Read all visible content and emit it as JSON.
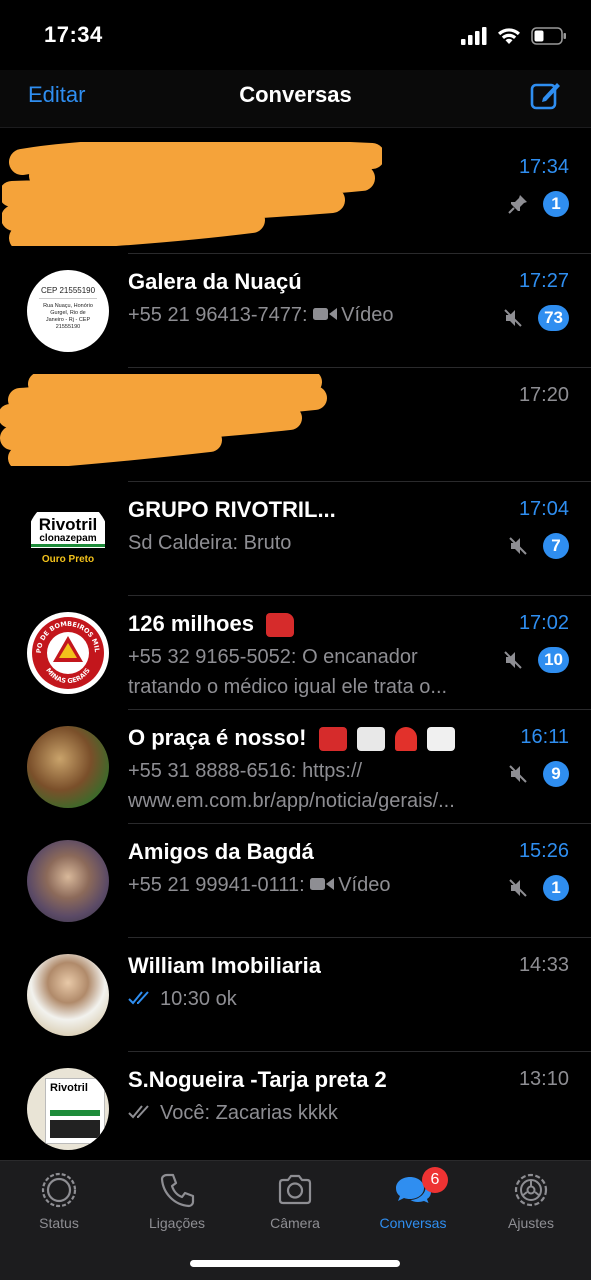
{
  "status_bar": {
    "time": "17:34"
  },
  "nav": {
    "edit_label": "Editar",
    "title": "Conversas"
  },
  "chats": [
    {
      "name": "",
      "preview": "",
      "time": "17:34",
      "time_unread": true,
      "pinned": true,
      "badge": "1"
    },
    {
      "name": "Galera da Nuaçú",
      "sender": "+55 21 96413-7477:",
      "preview": "Vídeo",
      "time": "17:27",
      "time_unread": true,
      "muted": true,
      "badge": "73",
      "avatar_text": {
        "line1": "CEP 21555190",
        "line2": "Rua Nuaçu, Honório Gurgel, Rio de Janeiro - Rj - CEP 21555190"
      }
    },
    {
      "name": "",
      "preview": "",
      "time": "17:20",
      "time_unread": false
    },
    {
      "name": "GRUPO RIVOTRIL...",
      "sender": "Sd Caldeira:",
      "preview": "Bruto",
      "time": "17:04",
      "time_unread": true,
      "muted": true,
      "badge": "7",
      "avatar_text": {
        "brand": "Rivotril",
        "drug": "clonazepam",
        "city": "Ouro Preto"
      }
    },
    {
      "name": "126 milhoes",
      "sender": "+55 32 9165-5052:",
      "preview": "O encanador tratando o médico igual ele trata o...",
      "time": "17:02",
      "time_unread": true,
      "muted": true,
      "badge": "10",
      "avatar_text": {
        "top": "CORPO DE BOMBEIROS MILITAR",
        "bottom": "MINAS GERAIS"
      }
    },
    {
      "name": "O praça é nosso!",
      "sender": "+55 31 8888-6516:",
      "preview": "https:// www.em.com.br/app/noticia/gerais/...",
      "time": "16:11",
      "time_unread": true,
      "muted": true,
      "badge": "9"
    },
    {
      "name": "Amigos da Bagdá",
      "sender": "+55 21 99941-0111:",
      "preview": "Vídeo",
      "time": "15:26",
      "time_unread": true,
      "muted": true,
      "badge": "1"
    },
    {
      "name": "William Imobiliaria",
      "preview": "10:30 ok",
      "time": "14:33",
      "time_unread": false,
      "read": true
    },
    {
      "name": "S.Nogueira -Tarja preta 2",
      "sender": "Você:",
      "preview": "Zacarias kkkk",
      "time": "13:10",
      "time_unread": false,
      "delivered": true,
      "avatar_text": {
        "brand": "Rivotril"
      }
    }
  ],
  "tabs": [
    {
      "label": "Status",
      "icon": "status-icon"
    },
    {
      "label": "Ligações",
      "icon": "phone-icon"
    },
    {
      "label": "Câmera",
      "icon": "camera-icon"
    },
    {
      "label": "Conversas",
      "icon": "chat-bubbles-icon",
      "active": true,
      "badge": "6"
    },
    {
      "label": "Ajustes",
      "icon": "gear-icon"
    }
  ],
  "colors": {
    "accent": "#2f8ef0",
    "background": "#000000",
    "secondary_text": "#8e8e93",
    "scribble": "#f5a33a",
    "tab_badge": "#ee3333"
  }
}
